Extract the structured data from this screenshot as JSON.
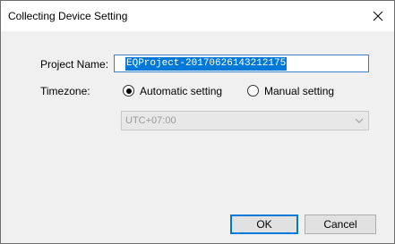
{
  "window": {
    "title": "Collecting Device Setting"
  },
  "form": {
    "project_name_label": "Project Name:",
    "project_name_value": "EQProject-20170626143212175",
    "timezone_label": "Timezone:",
    "timezone_options": [
      {
        "label": "Automatic setting",
        "checked": true
      },
      {
        "label": "Manual setting",
        "checked": false
      }
    ],
    "timezone_select_value": "UTC+07:00"
  },
  "buttons": {
    "ok": "OK",
    "cancel": "Cancel"
  },
  "icons": {
    "close": "close-icon",
    "dropdown": "chevron-down-icon"
  },
  "colors": {
    "selection": "#0078d7",
    "focus_border": "#3c7fc9"
  }
}
